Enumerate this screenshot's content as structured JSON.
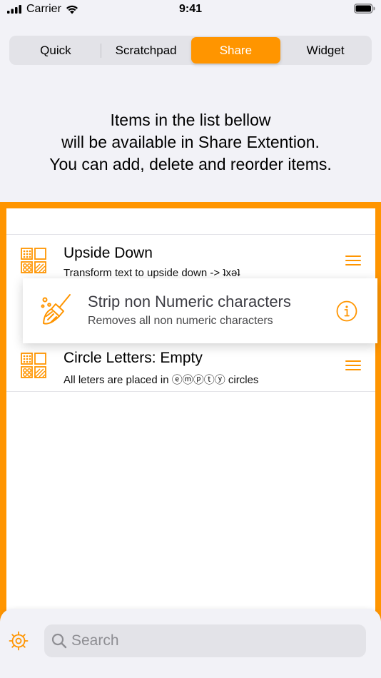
{
  "status_bar": {
    "carrier": "Carrier",
    "time": "9:41"
  },
  "segments": [
    "Quick",
    "Scratchpad",
    "Share",
    "Widget"
  ],
  "active_segment": "Share",
  "instructions": [
    "Items in the list bellow",
    "will be available in Share Extention.",
    "You can add, delete and reorder items."
  ],
  "list": {
    "items": [
      {
        "title": "Upside Down",
        "subtitle": "Transform text to upside down -> ʇxǝʇ",
        "icon": "grid-pattern-icon"
      },
      {
        "title": "Circle Letters: Empty",
        "subtitle": "All leters are placed in ⓔⓜⓟⓣⓨ circles",
        "icon": "grid-pattern-icon"
      }
    ],
    "dragging_item": {
      "title": "Strip non Numeric characters",
      "subtitle": "Removes all non numeric characters",
      "icon": "broom-icon"
    }
  },
  "search": {
    "placeholder": "Search"
  },
  "colors": {
    "accent": "#ff9500",
    "background": "#f2f2f7"
  }
}
